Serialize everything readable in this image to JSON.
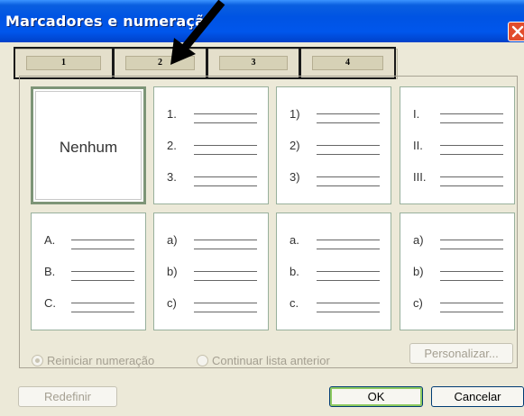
{
  "window": {
    "title": "Marcadores e numeraçã"
  },
  "tabs": [
    {
      "label": "1"
    },
    {
      "label": "2"
    },
    {
      "label": "3"
    },
    {
      "label": "4"
    }
  ],
  "gallery": {
    "none_label": "Nenhum",
    "styles": [
      {
        "markers": [
          "1.",
          "2.",
          "3."
        ]
      },
      {
        "markers": [
          "1)",
          "2)",
          "3)"
        ]
      },
      {
        "markers": [
          "I.",
          "II.",
          "III."
        ]
      },
      {
        "markers": [
          "A.",
          "B.",
          "C."
        ]
      },
      {
        "markers": [
          "a)",
          "b)",
          "c)"
        ]
      },
      {
        "markers": [
          "a.",
          "b.",
          "c."
        ]
      },
      {
        "markers": [
          "a)",
          "b)",
          "c)"
        ]
      }
    ]
  },
  "options": {
    "restart_label": "Reiniciar numeração",
    "continue_label": "Continuar lista anterior",
    "customize_label": "Personalizar..."
  },
  "buttons": {
    "reset_label": "Redefinir",
    "ok_label": "OK",
    "cancel_label": "Cancelar"
  },
  "colors": {
    "titlebar": "#0054e3",
    "dialog_bg": "#ece9d8",
    "close": "#e24d2c",
    "ok_focus": "#8cc95f"
  }
}
